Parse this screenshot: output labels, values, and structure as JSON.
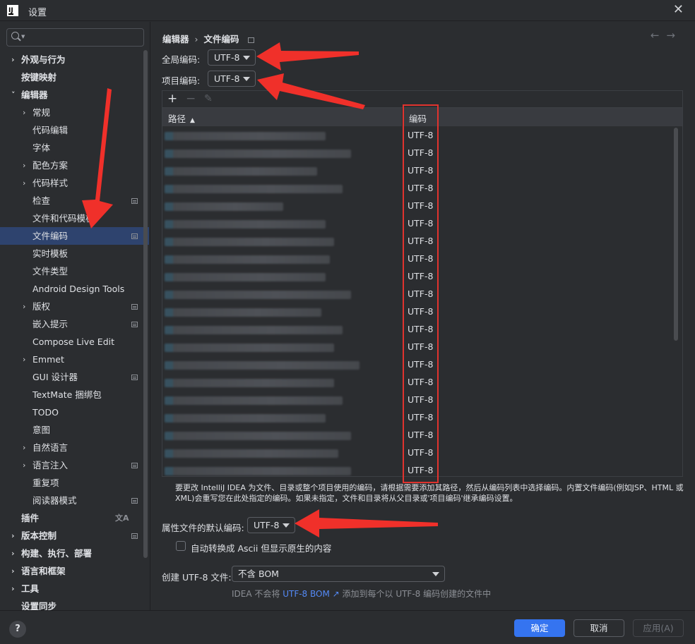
{
  "window": {
    "title": "设置",
    "logo_text": "IJ"
  },
  "sidebar": {
    "search_placeholder": "",
    "items": [
      {
        "label": "外观与行为",
        "level": 0,
        "arrow": "›",
        "bold": true
      },
      {
        "label": "按键映射",
        "level": 0,
        "arrow": "",
        "bold": true
      },
      {
        "label": "编辑器",
        "level": 0,
        "arrow": "˅",
        "bold": true
      },
      {
        "label": "常规",
        "level": 1,
        "arrow": "›"
      },
      {
        "label": "代码编辑",
        "level": 1,
        "arrow": ""
      },
      {
        "label": "字体",
        "level": 1,
        "arrow": ""
      },
      {
        "label": "配色方案",
        "level": 1,
        "arrow": "›"
      },
      {
        "label": "代码样式",
        "level": 1,
        "arrow": "›"
      },
      {
        "label": "检查",
        "level": 1,
        "arrow": "",
        "badge": true
      },
      {
        "label": "文件和代码模板",
        "level": 1,
        "arrow": ""
      },
      {
        "label": "文件编码",
        "level": 1,
        "arrow": "",
        "badge": true,
        "selected": true
      },
      {
        "label": "实时模板",
        "level": 1,
        "arrow": ""
      },
      {
        "label": "文件类型",
        "level": 1,
        "arrow": ""
      },
      {
        "label": "Android Design Tools",
        "level": 1,
        "arrow": ""
      },
      {
        "label": "版权",
        "level": 1,
        "arrow": "›",
        "badge": true
      },
      {
        "label": "嵌入提示",
        "level": 1,
        "arrow": "",
        "badge": true
      },
      {
        "label": "Compose Live Edit",
        "level": 1,
        "arrow": ""
      },
      {
        "label": "Emmet",
        "level": 1,
        "arrow": "›"
      },
      {
        "label": "GUI 设计器",
        "level": 1,
        "arrow": "",
        "badge": true
      },
      {
        "label": "TextMate 捆绑包",
        "level": 1,
        "arrow": ""
      },
      {
        "label": "TODO",
        "level": 1,
        "arrow": ""
      },
      {
        "label": "意图",
        "level": 1,
        "arrow": ""
      },
      {
        "label": "自然语言",
        "level": 1,
        "arrow": "›"
      },
      {
        "label": "语言注入",
        "level": 1,
        "arrow": "›",
        "badge": true
      },
      {
        "label": "重复项",
        "level": 1,
        "arrow": ""
      },
      {
        "label": "阅读器模式",
        "level": 1,
        "arrow": "",
        "badge": true
      },
      {
        "label": "插件",
        "level": 0,
        "arrow": "",
        "bold": true,
        "lang_icon": true
      },
      {
        "label": "版本控制",
        "level": 0,
        "arrow": "›",
        "bold": true,
        "badge": true
      },
      {
        "label": "构建、执行、部署",
        "level": 0,
        "arrow": "›",
        "bold": true
      },
      {
        "label": "语言和框架",
        "level": 0,
        "arrow": "›",
        "bold": true
      },
      {
        "label": "工具",
        "level": 0,
        "arrow": "›",
        "bold": true
      },
      {
        "label": "设置同步",
        "level": 0,
        "arrow": "",
        "bold": true
      }
    ]
  },
  "breadcrumb": {
    "parent": "编辑器",
    "separator": "›",
    "current": "文件编码"
  },
  "nav": {
    "back": "←",
    "forward": "→"
  },
  "global_encoding": {
    "label": "全局编码:",
    "value": "UTF-8"
  },
  "project_encoding": {
    "label": "项目编码:",
    "value": "UTF-8"
  },
  "table": {
    "toolbar": {
      "add": "+",
      "remove": "−",
      "edit": "✎"
    },
    "columns": {
      "path": "路径",
      "sort_icon": "▲",
      "encoding": "编码"
    },
    "rows": [
      {
        "encoding": "UTF-8",
        "blur_width": 228
      },
      {
        "encoding": "UTF-8",
        "blur_width": 264
      },
      {
        "encoding": "UTF-8",
        "blur_width": 216
      },
      {
        "encoding": "UTF-8",
        "blur_width": 252
      },
      {
        "encoding": "UTF-8",
        "blur_width": 168
      },
      {
        "encoding": "UTF-8",
        "blur_width": 228
      },
      {
        "encoding": "UTF-8",
        "blur_width": 240
      },
      {
        "encoding": "UTF-8",
        "blur_width": 234
      },
      {
        "encoding": "UTF-8",
        "blur_width": 228
      },
      {
        "encoding": "UTF-8",
        "blur_width": 264
      },
      {
        "encoding": "UTF-8",
        "blur_width": 222
      },
      {
        "encoding": "UTF-8",
        "blur_width": 252
      },
      {
        "encoding": "UTF-8",
        "blur_width": 240
      },
      {
        "encoding": "UTF-8",
        "blur_width": 276
      },
      {
        "encoding": "UTF-8",
        "blur_width": 240
      },
      {
        "encoding": "UTF-8",
        "blur_width": 252
      },
      {
        "encoding": "UTF-8",
        "blur_width": 228
      },
      {
        "encoding": "UTF-8",
        "blur_width": 264
      },
      {
        "encoding": "UTF-8",
        "blur_width": 246
      },
      {
        "encoding": "UTF-8",
        "blur_width": 264
      }
    ]
  },
  "description": "要更改 IntelliJ IDEA 为文件、目录或整个项目使用的编码，请根据需要添加其路径，然后从编码列表中选择编码。内置文件编码(例如JSP、HTML 或 XML)会重写您在此处指定的编码。如果未指定，文件和目录将从父目录或'项目编码'继承编码设置。",
  "properties_encoding": {
    "label": "属性文件的默认编码:",
    "value": "UTF-8"
  },
  "ascii_checkbox": {
    "label": "自动转换成 Ascii 但显示原生的内容",
    "checked": false
  },
  "bom": {
    "label": "创建 UTF-8 文件:",
    "value": "不含 BOM"
  },
  "hint": {
    "prefix": "IDEA 不会将 ",
    "link": "UTF-8 BOM ↗",
    "suffix": " 添加到每个以 UTF-8 编码创建的文件中"
  },
  "buttons": {
    "help": "?",
    "ok": "确定",
    "cancel": "取消",
    "apply": "应用(A)"
  },
  "colors": {
    "accent": "#3574f0",
    "selection": "#2e436e",
    "annotation_red": "#e0332e",
    "link": "#548af7"
  }
}
